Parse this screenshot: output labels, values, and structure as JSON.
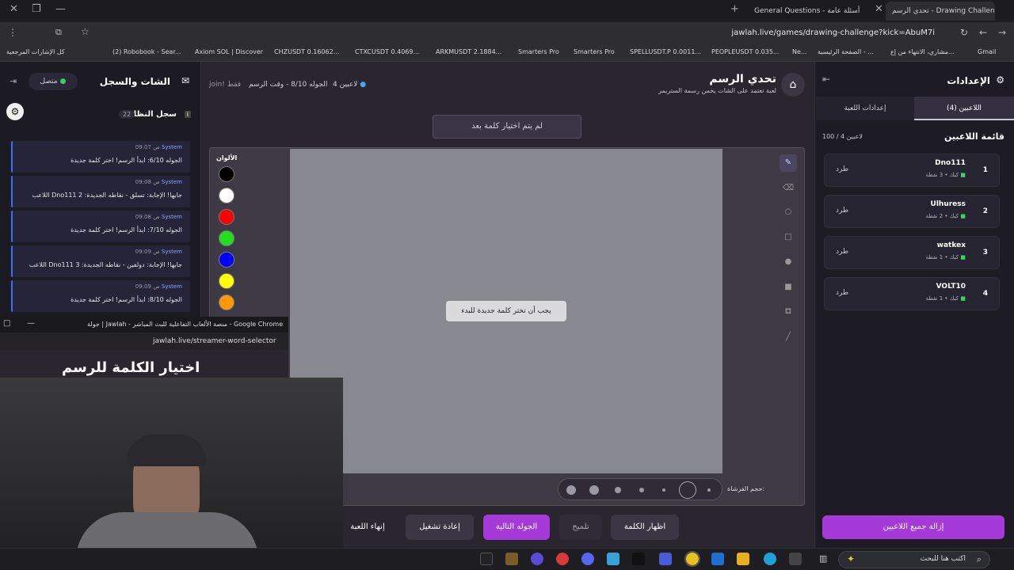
{
  "browser": {
    "tabs": [
      {
        "label": "General Questions - أسئلة عامة"
      },
      {
        "label": "تحدي الرسم - Drawing Challenge"
      }
    ],
    "url": "jawlah.live/games/drawing-challenge?kick=AbuM7i",
    "bookmarks": [
      "كل الإشارات المرجعية",
      "(2) Robobook - Sear...",
      "Axiom SOL | Discover",
      "CHZUSDT 0.16062...",
      "CTXCUSDT 0.4069...",
      "ARKMUSDT 2.1884...",
      "Smarters Pro",
      "Smarters Pro",
      "SPELLUSDT.P 0.0011...",
      "PEOPLEUSDT 0.035...",
      "Ne...",
      "الصفحة الرئيسية - ...",
      "مشاري، الانتهاء من إع...",
      "Gmail"
    ]
  },
  "chat": {
    "title": "الشات والسجل",
    "status": "متصل",
    "log_title": "سجل النظام",
    "log_count": "22",
    "messages": [
      {
        "sender": "System",
        "time": "09:07 ص",
        "text": "الجوله 6/10: ابدأ الرسم! اختر كلمة جديدة"
      },
      {
        "sender": "System",
        "time": "09:08 ص",
        "text": "اللاعب Dno111 جابها! الإجابة: تسلق - نقاطه الجديدة: 2"
      },
      {
        "sender": "System",
        "time": "09:08 ص",
        "text": "الجوله 7/10: ابدأ الرسم! اختر كلمة جديدة"
      },
      {
        "sender": "System",
        "time": "09:09 ص",
        "text": "اللاعب Dno111 جابها! الإجابة: دولفين - نقاطه الجديدة: 3"
      },
      {
        "sender": "System",
        "time": "09:09 ص",
        "text": "الجوله 8/10: ابدأ الرسم! اختر كلمة جديدة"
      }
    ]
  },
  "game": {
    "title": "تحدي الرسم",
    "subtitle": "لعبة تعتمد على الشات يخمن رسمة الستريمر",
    "players_status": "4 لاعبين",
    "round_info": "الجوله 8/10 - وقت الرسم",
    "join_hint": "join! فقط",
    "waiting_word": "لم يتم اختيار كلمة بعد",
    "canvas_msg": "يجب أن تختر كلمة جديدة للبدء",
    "colors_label": "الألوان",
    "brush_label": "حجم الفرشاة:",
    "colors": [
      "#000000",
      "#ffffff",
      "#ff0000",
      "#22dd22",
      "#0000ff",
      "#ffff00",
      "#ff9900"
    ],
    "buttons": {
      "show_word": "اظهار الكلمة",
      "hint": "تلميح",
      "next_round": "الجوله التالية",
      "restart": "إعادة تشغيل",
      "end_game": "إنهاء اللعبة"
    }
  },
  "settings": {
    "title": "الإعدادات",
    "tab_players": "اللاعبين (4)",
    "tab_game": "إعدادات اللعبة",
    "players_title": "قائمة اللاعبين",
    "players_count": "100 / 4 لاعبين",
    "kick_label": "طرد",
    "players": [
      {
        "rank": "1",
        "name": "Dno111",
        "points": "كيك • 3 نقطة"
      },
      {
        "rank": "2",
        "name": "Ulhuress",
        "points": "كيك • 2 نقطة"
      },
      {
        "rank": "3",
        "name": "watkex",
        "points": "كيك • 1 نقطة"
      },
      {
        "rank": "4",
        "name": "VOLT10",
        "points": "كيك • 1 نقطة"
      }
    ],
    "remove_all": "إزالة جميع اللاعبين"
  },
  "overlay": {
    "window_title": "جولة | Jawlah - منصة الألعاب التفاعلية للبث المباشر - Google Chrome",
    "url": "jawlah.live/streamer-word-selector",
    "heading": "اختيار الكلمة للرسم"
  },
  "taskbar": {
    "search_placeholder": "اكتب هنا للبحث"
  }
}
